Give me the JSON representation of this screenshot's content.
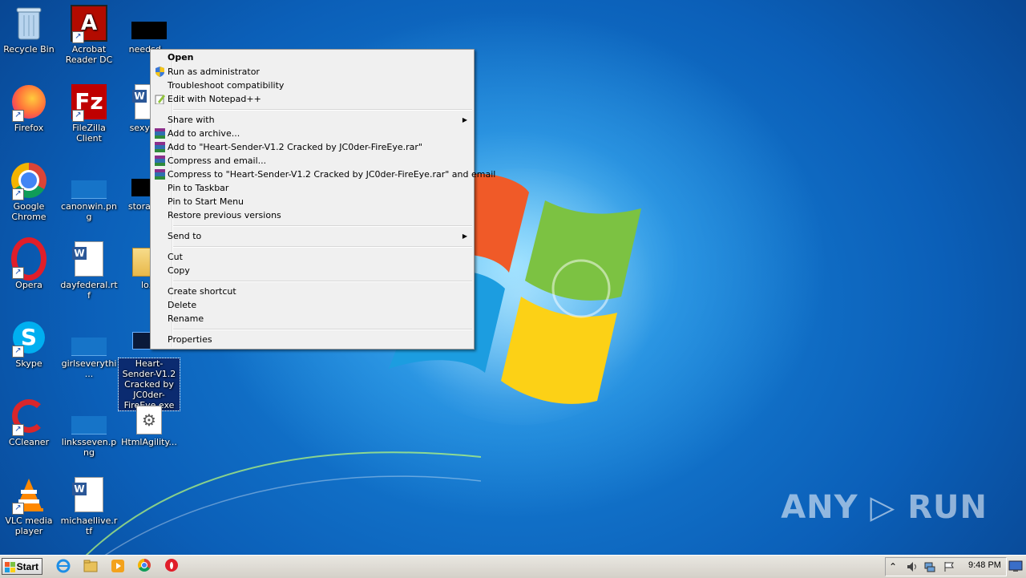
{
  "desktop_icons": [
    {
      "name": "recycle-bin",
      "label": "Recycle Bin"
    },
    {
      "name": "acrobat-reader",
      "label": "Acrobat Reader DC"
    },
    {
      "name": "needsd",
      "label": "needsd..."
    },
    {
      "name": "firefox",
      "label": "Firefox"
    },
    {
      "name": "filezilla",
      "label": "FileZilla Client"
    },
    {
      "name": "sexych",
      "label": "sexych..."
    },
    {
      "name": "chrome",
      "label": "Google Chrome"
    },
    {
      "name": "canonwin",
      "label": "canonwin.png"
    },
    {
      "name": "storage",
      "label": "storage..."
    },
    {
      "name": "opera",
      "label": "Opera"
    },
    {
      "name": "dayfederal",
      "label": "dayfederal.rtf"
    },
    {
      "name": "lo",
      "label": "lo..."
    },
    {
      "name": "skype",
      "label": "Skype"
    },
    {
      "name": "girlseverything",
      "label": "girlseverythi..."
    },
    {
      "name": "heart-sender",
      "label": "Heart-Sender-V1.2 Cracked by JC0der-FireEye.exe"
    },
    {
      "name": "ccleaner",
      "label": "CCleaner"
    },
    {
      "name": "linksseven",
      "label": "linksseven.png"
    },
    {
      "name": "htmlagility",
      "label": "HtmlAgility..."
    },
    {
      "name": "vlc",
      "label": "VLC media player"
    },
    {
      "name": "michaellive",
      "label": "michaellive.rtf"
    }
  ],
  "context_menu": {
    "items": [
      {
        "label": "Open",
        "bold": true
      },
      {
        "label": "Run as administrator",
        "icon": "uac-shield-icon"
      },
      {
        "label": "Troubleshoot compatibility"
      },
      {
        "label": "Edit with Notepad++",
        "icon": "notepadpp-icon"
      },
      {
        "label": "Share with",
        "submenu": true
      },
      {
        "label": "Add to archive...",
        "icon": "winrar-icon"
      },
      {
        "label": "Add to \"Heart-Sender-V1.2 Cracked by JC0der-FireEye.rar\"",
        "icon": "winrar-icon"
      },
      {
        "label": "Compress and email...",
        "icon": "winrar-icon"
      },
      {
        "label": "Compress to \"Heart-Sender-V1.2 Cracked by JC0der-FireEye.rar\" and email",
        "icon": "winrar-icon"
      },
      {
        "label": "Pin to Taskbar"
      },
      {
        "label": "Pin to Start Menu"
      },
      {
        "label": "Restore previous versions"
      },
      {
        "label": "Send to",
        "submenu": true
      },
      {
        "label": "Cut"
      },
      {
        "label": "Copy"
      },
      {
        "label": "Create shortcut"
      },
      {
        "label": "Delete"
      },
      {
        "label": "Rename"
      },
      {
        "label": "Properties"
      }
    ],
    "submenu_arrow": "▶"
  },
  "taskbar": {
    "start_label": "Start",
    "pinned": [
      "internet-explorer-icon",
      "explorer-icon",
      "media-player-icon",
      "chrome-icon",
      "opera-icon"
    ],
    "tray_expand": "⌃",
    "clock": "9:48 PM"
  },
  "watermark": "ANY ▷ RUN",
  "colors": {
    "selection": "#0b2b70",
    "menu_bg": "#f0f0f0",
    "desktop": "#0b5fb8"
  }
}
